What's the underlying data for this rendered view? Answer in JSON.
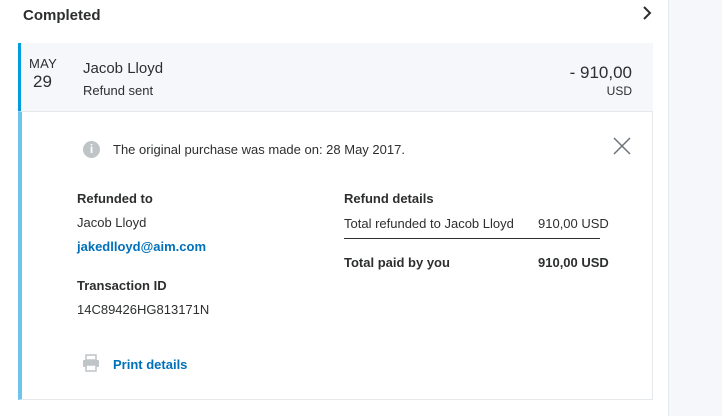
{
  "section": {
    "title": "Completed"
  },
  "transaction": {
    "month": "MAY",
    "day": "29",
    "name": "Jacob Lloyd",
    "status": "Refund sent",
    "amount": "- 910,00",
    "currency": "USD"
  },
  "details": {
    "info_text": "The original purchase was made on: 28 May 2017.",
    "refunded_to_label": "Refunded to",
    "refunded_to_name": "Jacob Lloyd",
    "refunded_to_email": "jakedlloyd@aim.com",
    "transaction_id_label": "Transaction ID",
    "transaction_id": "14C89426HG813171N",
    "refund_details_label": "Refund details",
    "total_refunded_label": "Total refunded to Jacob Lloyd",
    "total_refunded_value": "910,00 USD",
    "total_paid_label": "Total paid by you",
    "total_paid_value": "910,00 USD",
    "print_label": "Print details"
  },
  "icons": {
    "chevron": "chevron-right-icon",
    "info": "info-icon",
    "close": "close-icon",
    "print": "printer-icon"
  },
  "colors": {
    "accent_blue": "#009cde",
    "details_border": "#6dc5ee",
    "link": "#0070ba",
    "text": "#2c2e2f"
  }
}
